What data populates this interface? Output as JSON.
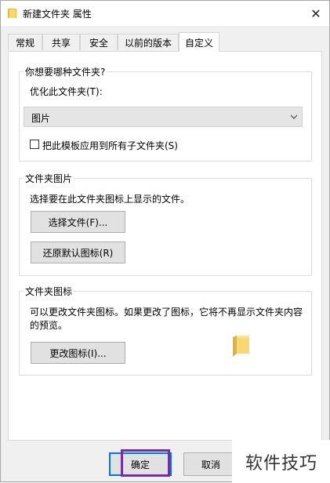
{
  "window": {
    "title": "新建文件夹 属性"
  },
  "tabs": [
    "常规",
    "共享",
    "安全",
    "以前的版本",
    "自定义"
  ],
  "active_tab_index": 4,
  "optimize_group": {
    "legend": "你想要哪种文件夹?",
    "label": "优化此文件夹(T):",
    "select_value": "图片",
    "checkbox_label": "把此模板应用到所有子文件夹(S)",
    "checkbox_checked": false
  },
  "pictures_group": {
    "legend": "文件夹图片",
    "description": "选择要在此文件夹图标上显示的文件。",
    "choose_file_label": "选择文件(F)...",
    "restore_default_label": "还原默认图标(R)"
  },
  "icons_group": {
    "legend": "文件夹图标",
    "description_line1": "可以更改文件夹图标。如果更改了图标，它将不再显示文件夹内容",
    "description_line2": "的预览。",
    "change_icon_label": "更改图标(I)..."
  },
  "footer": {
    "ok_label": "确定",
    "cancel_label": "取消"
  },
  "watermark": "软件技巧",
  "colors": {
    "accent": "#0078d7",
    "highlight": "#7030a0",
    "folder": "#f8d775"
  }
}
